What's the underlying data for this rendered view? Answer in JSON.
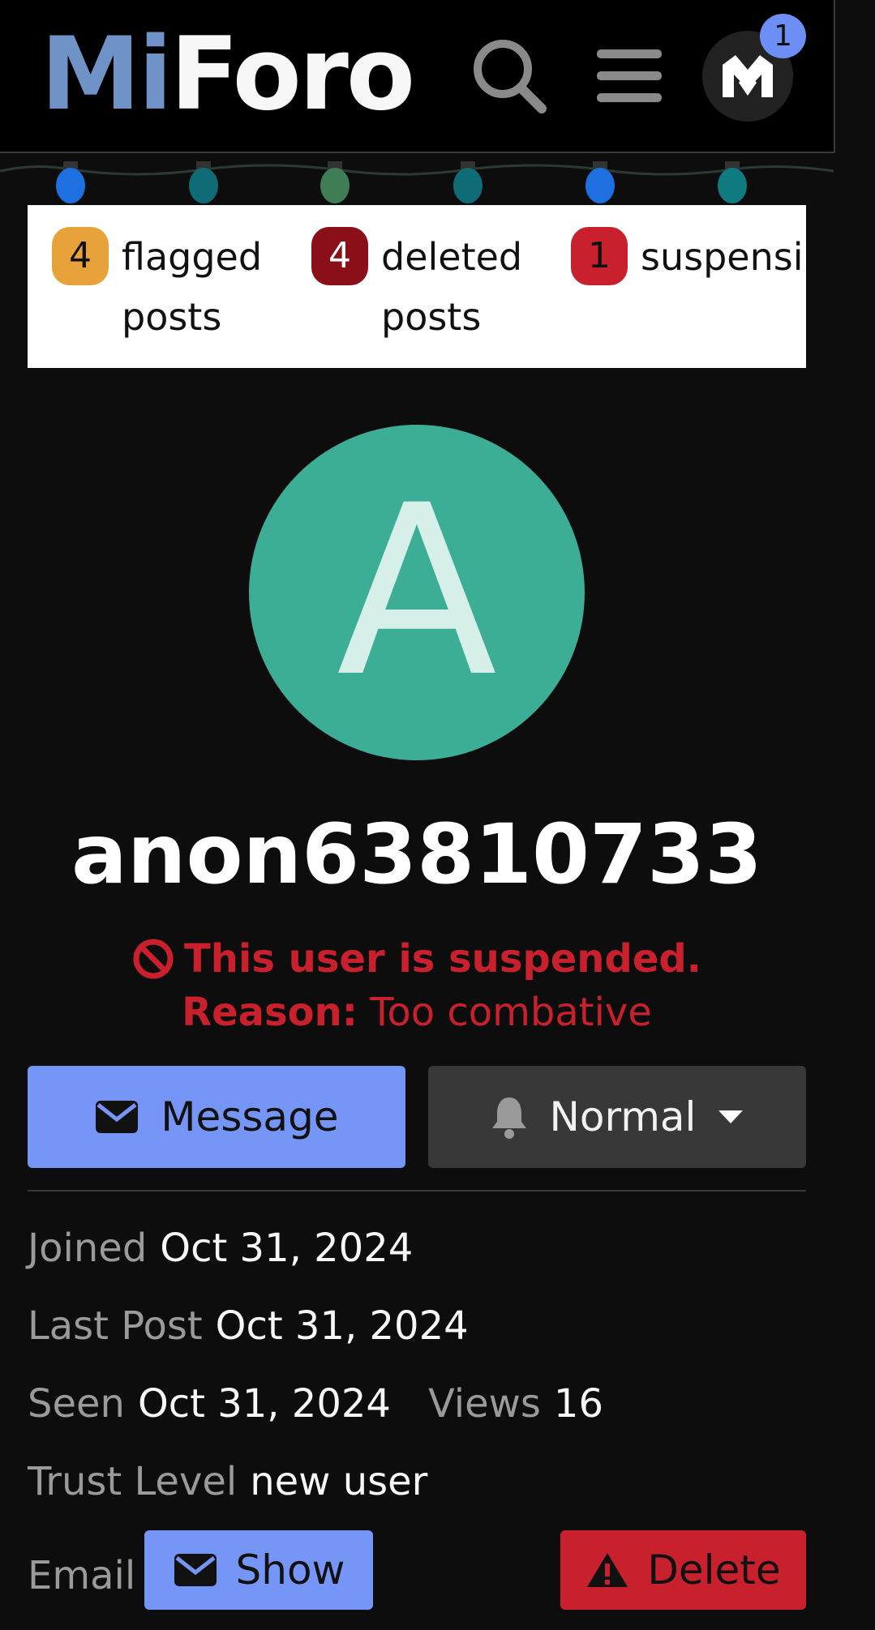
{
  "header": {
    "logo_part1": "Mi",
    "logo_part2": "Foro",
    "notification_count": "1",
    "search_icon": "search-icon",
    "menu_icon": "hamburger-menu-icon",
    "avatar_icon": "user-avatar-icon"
  },
  "stats": [
    {
      "count": "4",
      "label": "flagged",
      "label2": "posts",
      "color": "#e8a23a"
    },
    {
      "count": "4",
      "label": "deleted",
      "label2": "posts",
      "color": "#8b0f19"
    },
    {
      "count": "1",
      "label": "suspensi",
      "label2": "",
      "color": "#c8202c"
    }
  ],
  "profile": {
    "avatar_letter": "A",
    "avatar_color": "#3cae95",
    "username": "anon63810733",
    "suspended_text": "This user is suspended.",
    "reason_label": "Reason:",
    "reason_value": "Too combative"
  },
  "actions": {
    "message_label": "Message",
    "notification_level": "Normal"
  },
  "details": {
    "joined_label": "Joined",
    "joined_value": "Oct 31, 2024",
    "last_post_label": "Last Post",
    "last_post_value": "Oct 31, 2024",
    "seen_label": "Seen",
    "seen_value": "Oct 31, 2024",
    "views_label": "Views",
    "views_value": "16",
    "trust_label": "Trust Level",
    "trust_value": "new user",
    "email_label": "Email",
    "show_label": "Show",
    "delete_label": "Delete"
  },
  "colors": {
    "accent": "#7595f7",
    "danger": "#c8202c",
    "background": "#0d0d0d"
  }
}
